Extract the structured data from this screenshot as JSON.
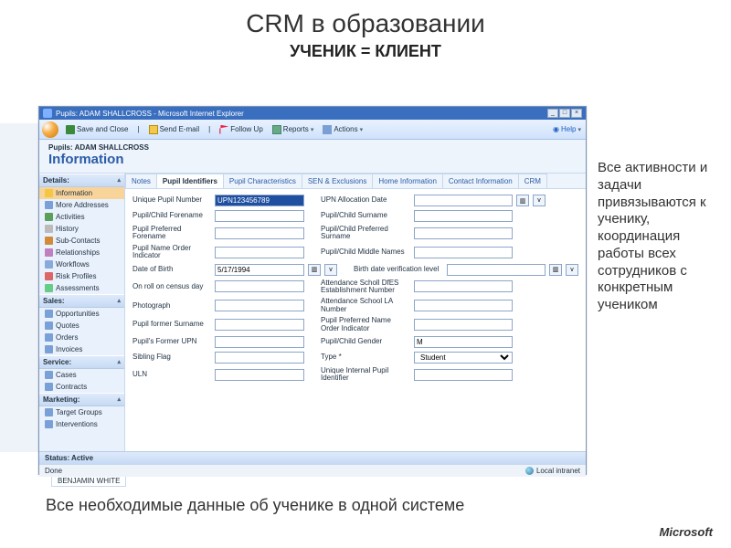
{
  "slide": {
    "title": "CRM в образовании",
    "subtitle": "УЧЕНИК = КЛИЕНТ",
    "side_text": "Все активности и задачи привязываются к ученику, координация работы всех сотрудников с конкретным учеником",
    "bottom_text": "Все необходимые данные об ученике в одной системе",
    "logo_text": "Microsoft"
  },
  "window": {
    "title": "Pupils: ADAM SHALLCROSS - Microsoft Internet Explorer",
    "toolbar": {
      "save": "Save and Close",
      "send": "Send E-mail",
      "follow": "Follow Up",
      "reports": "Reports",
      "actions": "Actions",
      "help": "Help"
    },
    "crumb": {
      "path": "Pupils: ADAM SHALLCROSS",
      "title": "Information"
    },
    "nav": {
      "details": "Details:",
      "sales": "Sales:",
      "service": "Service:",
      "marketing": "Marketing:",
      "items_details": [
        {
          "label": "Information",
          "sel": true,
          "cls": "ni-info"
        },
        {
          "label": "More Addresses",
          "cls": "ni-addr"
        },
        {
          "label": "Activities",
          "cls": "ni-act"
        },
        {
          "label": "History",
          "cls": "ni-hist"
        },
        {
          "label": "Sub-Contacts",
          "cls": "ni-sub"
        },
        {
          "label": "Relationships",
          "cls": "ni-rel"
        },
        {
          "label": "Workflows",
          "cls": "ni-wf"
        },
        {
          "label": "Risk Profiles",
          "cls": "ni-risk"
        },
        {
          "label": "Assessments",
          "cls": "ni-ass"
        }
      ],
      "items_sales": [
        "Opportunities",
        "Quotes",
        "Orders",
        "Invoices"
      ],
      "items_service": [
        "Cases",
        "Contracts"
      ],
      "items_marketing": [
        "Target Groups",
        "Interventions"
      ]
    },
    "tabs": [
      "Notes",
      "Pupil Identifiers",
      "Pupil Characteristics",
      "SEN & Exclusions",
      "Home Information",
      "Contact Information",
      "CRM"
    ],
    "active_tab": 1,
    "form": {
      "left": [
        {
          "label": "Unique Pupil Number",
          "value": "UPN123456789",
          "hl": true
        },
        {
          "label": "Pupil/Child Forename",
          "value": ""
        },
        {
          "label": "Pupil Preferred Forename",
          "value": ""
        },
        {
          "label": "Pupil Name Order Indicator",
          "value": ""
        },
        {
          "label": "Date of Birth",
          "value": "5/17/1994",
          "date": true
        },
        {
          "label": "On roll on census day",
          "value": ""
        },
        {
          "label": "Photograph",
          "value": ""
        },
        {
          "label": "Pupil former Surname",
          "value": ""
        },
        {
          "label": "Pupil's Former UPN",
          "value": ""
        },
        {
          "label": "Sibling Flag",
          "value": ""
        },
        {
          "label": "ULN",
          "value": ""
        }
      ],
      "right": [
        {
          "label": "UPN Allocation Date",
          "value": "",
          "date": true
        },
        {
          "label": "Pupil/Child Surname",
          "value": ""
        },
        {
          "label": "Pupil/Child Preferred Surname",
          "value": ""
        },
        {
          "label": "Pupil/Child Middle Names",
          "value": ""
        },
        {
          "label": "Birth date verification level",
          "value": "",
          "date": true
        },
        {
          "label": "Attendance Scholl DfES Establishment Number",
          "value": ""
        },
        {
          "label": "Attendance School LA Number",
          "value": ""
        },
        {
          "label": "Pupil Preferred Name Order Indicator",
          "value": ""
        },
        {
          "label": "Pupil/Child Gender",
          "value": "M"
        },
        {
          "label": "Type *",
          "value": "Student",
          "select": true
        },
        {
          "label": "Unique Internal Pupil Identifier",
          "value": ""
        }
      ]
    },
    "status": "Status: Active",
    "ie_done": "Done",
    "ie_zone": "Local intranet",
    "behind_row": "BENJAMIN WHITE"
  }
}
